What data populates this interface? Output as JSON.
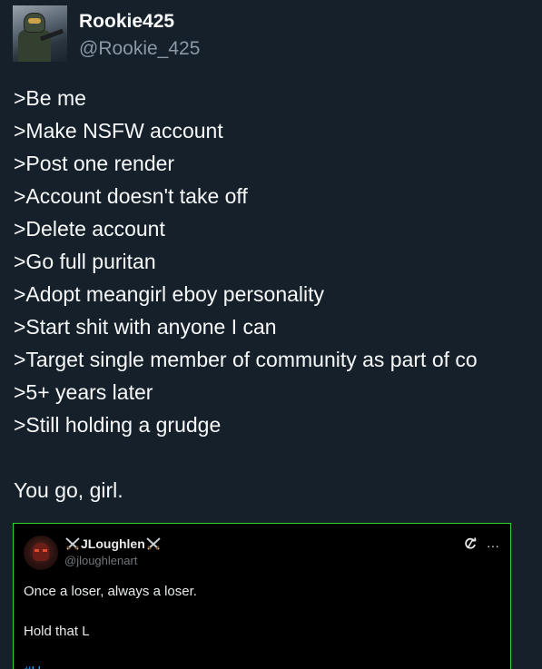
{
  "author": {
    "display_name": "Rookie425",
    "handle": "@Rookie_425"
  },
  "tweet": {
    "lines": [
      ">Be me",
      ">Make NSFW account",
      ">Post one render",
      ">Account doesn't take off",
      ">Delete account",
      ">Go full puritan",
      ">Adopt meangirl eboy personality",
      ">Start shit with anyone I can",
      ">Target single member of community as part of co",
      ">5+ years later",
      ">Still holding a grudge"
    ],
    "closing": "You go, girl."
  },
  "quote": {
    "border_color": "#2ed12e",
    "display_name": "JLoughlen",
    "name_decoration_icon": "crossed-swords-icon",
    "handle": "@jloughlenart",
    "action_icons": [
      "refresh-icon",
      "more-icon"
    ],
    "more_label": "···",
    "line1": "Once a loser, always a loser.",
    "line2": "Hold that L",
    "line3_partial": "#H..."
  }
}
